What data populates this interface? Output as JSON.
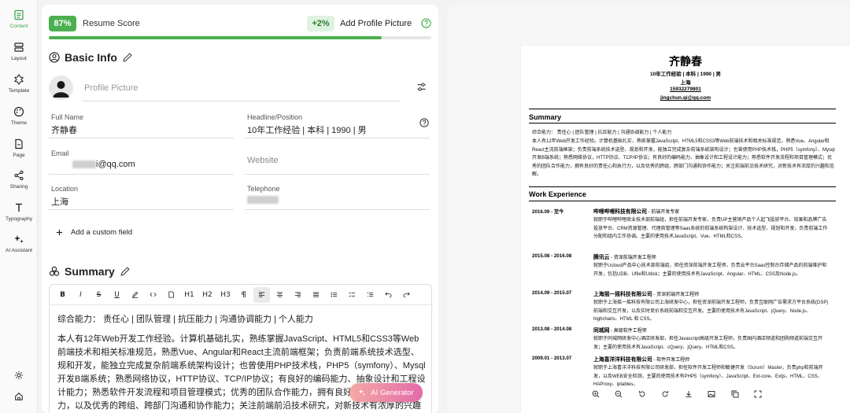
{
  "sidebar": {
    "items": [
      {
        "label": "Content",
        "icon": "content-icon"
      },
      {
        "label": "Layout",
        "icon": "layout-icon"
      },
      {
        "label": "Template",
        "icon": "template-icon"
      },
      {
        "label": "Theme",
        "icon": "theme-icon"
      },
      {
        "label": "Page",
        "icon": "page-icon"
      },
      {
        "label": "Sharing",
        "icon": "sharing-icon"
      },
      {
        "label": "Typography",
        "icon": "typography-icon"
      },
      {
        "label": "AI Assistant",
        "icon": "ai-assistant-icon"
      }
    ],
    "bottom": [
      "settings-icon",
      "home-icon"
    ],
    "accent": "#3aa14a"
  },
  "score": {
    "value": "87%",
    "label": "Resume Score",
    "bonus": "+2%",
    "tip": "Add Profile Picture",
    "progress": 0.87
  },
  "basic_info": {
    "title": "Basic Info",
    "picture_placeholder": "Profile Picture",
    "fields": {
      "full_name": {
        "label": "Full Name",
        "value": "齐静春"
      },
      "headline": {
        "label": "Headline/Position",
        "value": "10年工作经验 | 本科 | 1990 | 男"
      },
      "email": {
        "label": "Email",
        "value": "i@qq.com"
      },
      "website": {
        "label": "Website"
      },
      "location": {
        "label": "Location",
        "value": "上海"
      },
      "telephone": {
        "label": "Telephone"
      }
    },
    "add_field": "Add a custom field"
  },
  "summary": {
    "title": "Summary",
    "toolbar": [
      "B",
      "I",
      "S",
      "U",
      "H1",
      "H2",
      "H3"
    ],
    "line1": "综合能力： 责任心 | 团队管理 | 抗压能力 | 沟通协调能力 | 个人能力",
    "line2": "本人有12年Web开发工作经验。计算机基础扎实，熟练掌握JavaScript、HTML5和CSS3等Web前端技术和相关标准规范，熟悉Vue、Angular和React主流前端框架；负责前端系统技术选型、规和开发，能独立完成复杂前端系统架构设计；也曾使用PHP技术栈，PHP5（symfony）、Mysql开发B端系统；熟悉网络协议，HTTP协议、TCP/IP协议；有良好的编码能力、抽象设计和工程设计能力；熟悉软件开发流程和项目管理模式；优秀的团队合作能力，拥有良好的责任心和执行力，以及优秀的跨组、跨部门沟通和协作能力；关注前端前沿技术研究，对新技术有浓厚的兴趣和",
    "ai_button": "AI Generator"
  },
  "resume": {
    "name": "齐静春",
    "meta": "10年工作经验 | 本科 | 1990 | 男",
    "city": "上海",
    "phone": "15932279801",
    "email": "jingchun.qi@qq.com",
    "summary_title": "Summary",
    "summary_line1": "综合能力： 责任心 | 团队管理 | 抗压能力 | 沟通协调能力 | 个人能力",
    "summary_body": "本人有12年Web开发工作经验。计算机基础扎实，熟练掌握JavaScript、HTML5和CSS3等Web前端技术和相关标准规范，熟悉Vue、Angular和React主流前端框架；负责前端系统技术选型、规划和开发，能独立完成复杂前端系统架构设计；也曾使用PHP技术栈，PHP5（symfony）、Mysql开发B端系统；熟悉网络协议，HTTP协议、TCP/IP协议；有良好的编码能力、抽象设计和工程设计能力；熟悉软件开发流程和项目管理模式；优秀的团队合作能力，拥有良好的责任心和执行力，以及优秀的跨组、跨部门沟通和协作能力；关注前端前沿技术研究，对新技术有浓厚的兴趣和见解。",
    "work_title": "Work Experience",
    "jobs": [
      {
        "date": "2016.09 - 至今",
        "company": "哔哩哔哩科技有限公司",
        "role": " - 前端开发专家",
        "desc": "就职于哔哩哔哩商业技术部前端组，担任前端开发专家，负责UP主营销产品个人起飞投放平台、效果和品牌广告投放平台、CRM资源管理、代理商管理等Saas系统的前端系统构架设计、技术选型、规划和开发，负责前端工作分配和组内工作协调。主要的使用技术JavaScript、Vue、HTML和CSS。"
      },
      {
        "date": "2015.08 - 2016.08",
        "company": "腾讯云",
        "role": " - 资深前端开发工程师",
        "desc": "就职于Ucloud产品中心技术部前端组，担任资深前端开发工程师，负责云平台Saas控制台存储产品的前端维护和开发，包括UDB、Ufile和Udisk；主要的使用技术有JavaScript、Angular、HTML、CSS及Node.js。"
      },
      {
        "date": "2014.09 - 2015.07",
        "company": "上海摇一摇科技有限公司",
        "role": " - 资深前端开发工程师",
        "desc": "就职于上海摇一摇科技有限公司上海研发中心，担任资深前端开发工程师，负责互联网广告需求方平台系统(DSP)前端和交互开发，以及实时竞价系统前端和交互开发。主要的使用技术有JavaScript、jQuery、Node.js、highcharts、HTML 和 CSS。"
      },
      {
        "date": "2013.08 - 2014.08",
        "company": "同城网",
        "role": " - 高级软件工程师",
        "desc": "就职于同城网研发中心酒店研发部，担任Javascript高级开发工程师，负责国内酒店频道和团购频道前端交互开发；主要的使用技术有JavaScript、cQuery、jQuery、HTML和CSS。"
      },
      {
        "date": "2009.01 - 2013.07",
        "company": "上海喜洋洋科技有限公司",
        "role": " - 软件开发工程师",
        "desc": "就职于上海喜洋洋科技有限公司研发部，担任软件开发工程师和敏捷开发（Scrum）Master，负责php和前端开发，以及WEB安全检测，主要的使用技术有PHP5（symfony）、JavaScript、Ext-core、Extjs、HTML、CSS、HAProxy、iptables。"
      }
    ]
  },
  "zoombar": [
    "zoom-in-icon",
    "zoom-out-icon",
    "reset-icon",
    "rotate-icon",
    "download-icon",
    "image-icon",
    "copy-icon",
    "fullscreen-icon"
  ]
}
